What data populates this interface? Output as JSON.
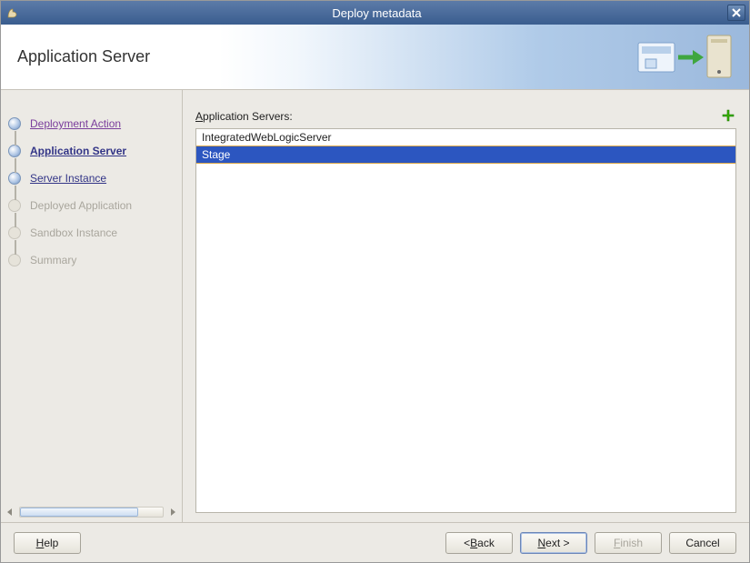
{
  "window": {
    "title": "Deploy metadata"
  },
  "header": {
    "title": "Application Server"
  },
  "steps": [
    {
      "label": "Deployment Action",
      "state": "visited"
    },
    {
      "label": "Application Server",
      "state": "current"
    },
    {
      "label": "Server Instance",
      "state": "upcoming"
    },
    {
      "label": "Deployed Application",
      "state": "disabled"
    },
    {
      "label": "Sandbox Instance",
      "state": "disabled"
    },
    {
      "label": "Summary",
      "state": "disabled"
    }
  ],
  "main": {
    "list_label_prefix": "A",
    "list_label_rest": "pplication Servers:",
    "servers": [
      {
        "name": "IntegratedWebLogicServer",
        "selected": false
      },
      {
        "name": "Stage",
        "selected": true
      }
    ]
  },
  "buttons": {
    "help_u": "H",
    "help_rest": "elp",
    "back_prefix": "< ",
    "back_u": "B",
    "back_rest": "ack",
    "next_u": "N",
    "next_rest": "ext >",
    "finish_prefix": "",
    "finish_u": "F",
    "finish_rest": "inish",
    "cancel": "Cancel"
  },
  "colors": {
    "titlebar_top": "#5c7ba8",
    "titlebar_bottom": "#3a5d8f",
    "selection": "#2c56c0",
    "link_visited": "#7a3d9c",
    "link_active": "#333587"
  }
}
